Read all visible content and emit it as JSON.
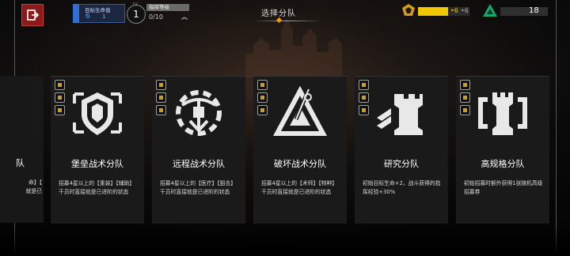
{
  "header": {
    "title": "选择分队",
    "goal": {
      "label": "目标生命值",
      "life": "6",
      "small": "1"
    },
    "level": {
      "lv": "LV",
      "value": "1"
    },
    "command": {
      "title": "指挥等级",
      "value": "0/10",
      "chevron": "︽"
    },
    "gold": {
      "current": "6",
      "sep": "•",
      "max": "6"
    },
    "tickets": "18"
  },
  "edge_card": {
    "name": "队",
    "desc": [
      "命】【",
      "就是已"
    ]
  },
  "cards": [
    {
      "name": "堡垒战术分队",
      "desc": "招募4星以上的【重装】【辅助】干员时直接就是已进阶的状态",
      "icon": "shield-emblem-icon"
    },
    {
      "name": "远程战术分队",
      "desc": "招募4星以上的【医疗】【狙击】干员时直接就是已进阶的状态",
      "icon": "crossbow-emblem-icon"
    },
    {
      "name": "破坏战术分队",
      "desc": "招募4星以上的【术师】【特种】干员时直接就是已进阶的状态",
      "icon": "triangle-emblem-icon"
    },
    {
      "name": "研究分队",
      "desc": "初始目标生命+2，战斗获得的指挥经验+30%",
      "icon": "rook-emblem-icon"
    },
    {
      "name": "高规格分队",
      "desc": "初始招募时额外获得1张随机高级招募券",
      "icon": "rook-bracket-emblem-icon"
    }
  ]
}
